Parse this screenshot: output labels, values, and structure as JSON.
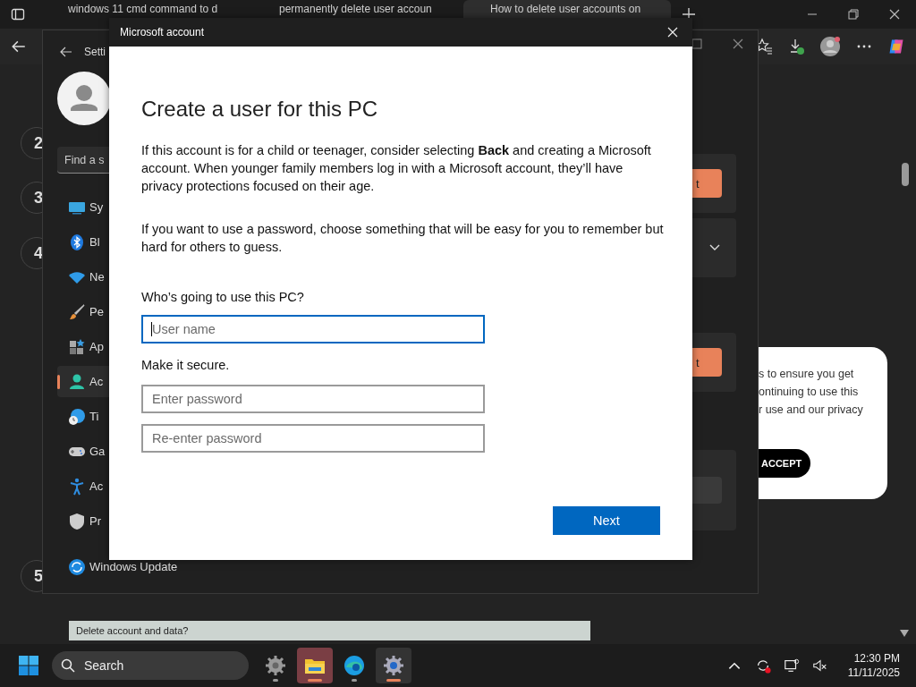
{
  "browser": {
    "tabs": [
      {
        "title": "windows 11 cmd command to d",
        "selected": false
      },
      {
        "title": "permanently delete user accoun",
        "selected": false
      },
      {
        "title": "How to delete user accounts on",
        "selected": true
      }
    ]
  },
  "article": {
    "step_numbers": [
      "2",
      "3",
      "4",
      "5"
    ],
    "cookie_notice": {
      "lines": [
        "s to ensure you get",
        "ontinuing to use this",
        "r use and our privacy"
      ],
      "button": "ACCEPT"
    },
    "footer_bar": "Delete account and data?"
  },
  "settings": {
    "title": "Setti",
    "search_placeholder": "Find a s",
    "nav": [
      {
        "label": "Sy",
        "selected": false
      },
      {
        "label": "Bl",
        "selected": false
      },
      {
        "label": "Ne",
        "selected": false
      },
      {
        "label": "Pe",
        "selected": false
      },
      {
        "label": "Ap",
        "selected": false
      },
      {
        "label": "Ac",
        "selected": true
      },
      {
        "label": "Ti",
        "selected": false
      },
      {
        "label": "Ga",
        "selected": false
      },
      {
        "label": "Ac",
        "selected": false
      },
      {
        "label": "Pr",
        "selected": false
      },
      {
        "label": "Windows Update",
        "selected": false
      }
    ],
    "buttons": [
      "t",
      "t"
    ]
  },
  "dialog": {
    "title": "Microsoft account",
    "heading": "Create a user for this PC",
    "paragraphs": [
      "If this account is for a child or teenager, consider selecting **Back** and creating a Microsoft account. When younger family members log in with a Microsoft account, they’ll have privacy protections focused on their age.",
      "If you want to use a password, choose something that will be easy for you to remember but hard for others to guess."
    ],
    "user_label": "Who’s going to use this PC?",
    "user_field": {
      "placeholder": "User name",
      "focused": true
    },
    "secure_label": "Make it secure.",
    "password_fields": [
      {
        "placeholder": "Enter password"
      },
      {
        "placeholder": "Re-enter password"
      }
    ],
    "next_button": "Next"
  },
  "taskbar": {
    "search": "Search",
    "apps": [
      {
        "selected": false
      },
      {
        "selected": true
      },
      {
        "selected": false
      },
      {
        "selected": true
      }
    ],
    "time": "12:30 PM",
    "date": "11/11/2025"
  }
}
